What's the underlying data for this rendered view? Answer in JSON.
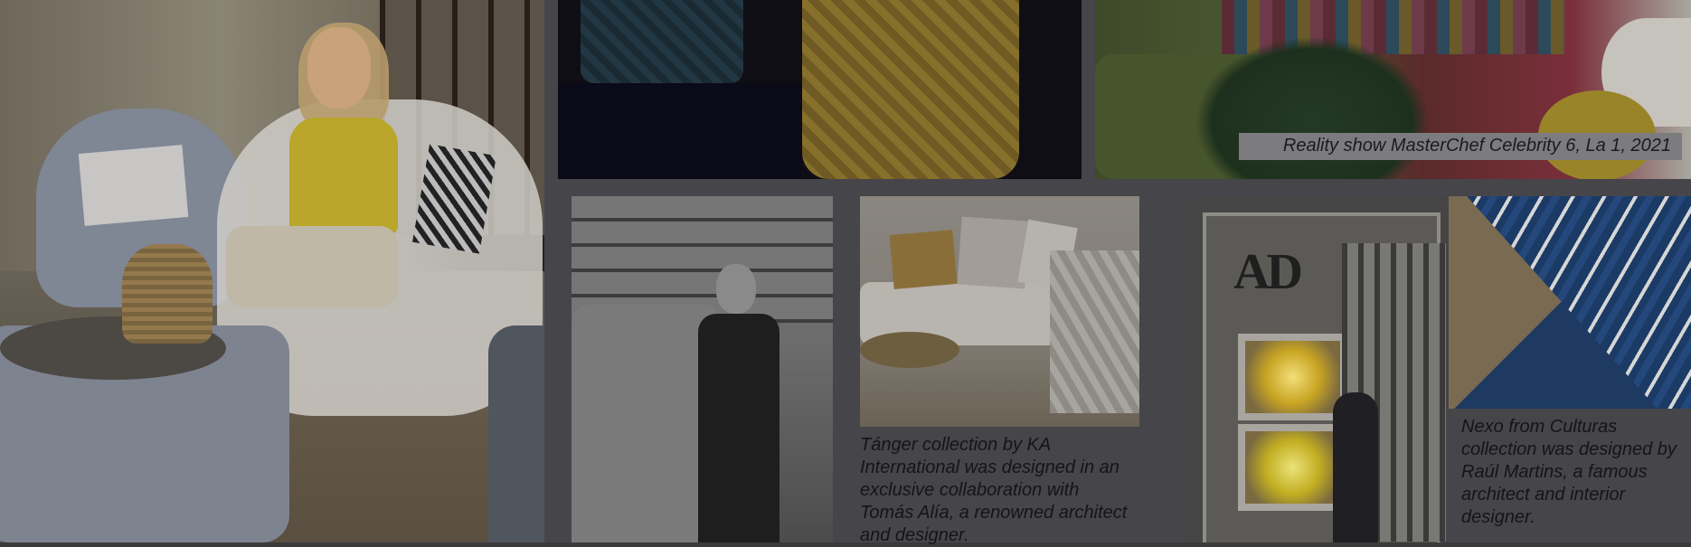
{
  "captions": {
    "masterchef": "Reality show MasterChef Celebrity 6, La 1, 2021",
    "tanger": "Tánger collection by KA International was designed in an exclusive collaboration with Tomás Alía, a renowned architect and designer.",
    "nexo": "Nexo from Culturas collection was designed by Raúl Martins, a famous architect and interior designer."
  },
  "magazine": {
    "logo": "AD"
  }
}
